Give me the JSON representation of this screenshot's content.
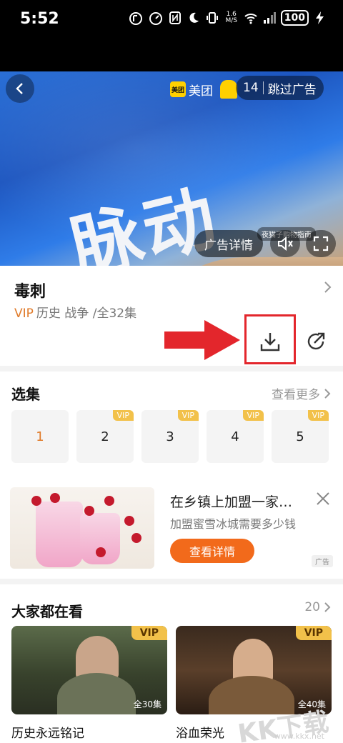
{
  "status_bar": {
    "time": "5:52",
    "net_speed_top": "1.6",
    "net_speed_unit": "M/S",
    "battery": "100"
  },
  "player": {
    "logo_text": "脉动",
    "brand_name": "美团",
    "brand_icon_text": "美团",
    "countdown": "14",
    "skip_label": "跳过广告",
    "ad_detail_label": "广告详情",
    "mini_banner_text": "夜猫子购物指南"
  },
  "show": {
    "title": "毒刺",
    "vip_label": "VIP",
    "meta": "历史 战争 /全32集"
  },
  "episodes": {
    "title": "选集",
    "more_label": "查看更多",
    "items": [
      {
        "label": "1",
        "vip": ""
      },
      {
        "label": "2",
        "vip": "VIP"
      },
      {
        "label": "3",
        "vip": "VIP"
      },
      {
        "label": "4",
        "vip": "VIP"
      },
      {
        "label": "5",
        "vip": "VIP"
      }
    ]
  },
  "ad_card": {
    "title": "在乡镇上加盟一家…",
    "subtitle": "加盟蜜雪冰城需要多少钱",
    "cta": "查看详情",
    "tag": "广告"
  },
  "trending": {
    "title": "大家都在看",
    "count": "20",
    "cards": [
      {
        "name": "历史永远铭记",
        "vip": "VIP",
        "episodes": "全30集"
      },
      {
        "name": "浴血荣光",
        "vip": "VIP",
        "episodes": "全40集"
      }
    ]
  },
  "watermark": {
    "text": "KK下载",
    "url": "www.kkx.net"
  },
  "colors": {
    "accent": "#e07b2a",
    "cta": "#f26a1b",
    "vip_badge": "#f2c14a",
    "highlight_red": "#e3262c"
  }
}
